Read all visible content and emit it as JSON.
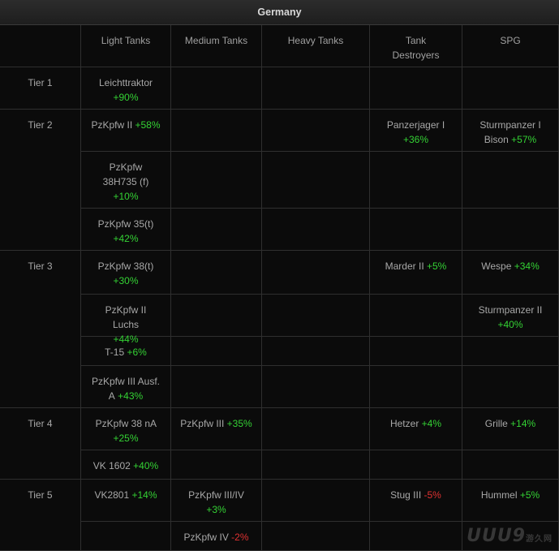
{
  "title": "Germany",
  "headers": [
    "",
    "Light Tanks",
    "Medium Tanks",
    "Heavy Tanks",
    "Tank Destroyers",
    "SPG"
  ],
  "tiers": [
    "Tier 1",
    "Tier 2",
    "Tier 3",
    "Tier 4",
    "Tier 5"
  ],
  "entries": {
    "r0_light": {
      "name": "Leichttraktor",
      "pct": "+90%"
    },
    "r1_light": {
      "name": "PzKpfw II",
      "pct": "+58%"
    },
    "r1_td": {
      "name": "Panzerjager I",
      "pct": "+36%"
    },
    "r1_spg": {
      "name": "Sturmpanzer I Bison",
      "pct": "+57%"
    },
    "r2_light": {
      "name": "PzKpfw 38H735 (f)",
      "pct": "+10%"
    },
    "r3_light": {
      "name": "PzKpfw 35(t)",
      "pct": "+42%"
    },
    "r4_light": {
      "name": "PzKpfw 38(t)",
      "pct": "+30%"
    },
    "r4_td": {
      "name": "Marder II",
      "pct": "+5%"
    },
    "r4_spg": {
      "name": "Wespe",
      "pct": "+34%"
    },
    "r5_light": {
      "name": "PzKpfw II Luchs",
      "pct": "+44%"
    },
    "r5_spg": {
      "name": "Sturmpanzer II",
      "pct": "+40%"
    },
    "r6_light": {
      "name": "T-15",
      "pct": "+6%"
    },
    "r7_light": {
      "name": "PzKpfw III Ausf. A",
      "pct": "+43%"
    },
    "r8_light": {
      "name": "PzKpfw 38 nA",
      "pct": "+25%"
    },
    "r8_medium": {
      "name": "PzKpfw III",
      "pct": "+35%"
    },
    "r8_td": {
      "name": "Hetzer",
      "pct": "+4%"
    },
    "r8_spg": {
      "name": "Grille",
      "pct": "+14%"
    },
    "r9_light": {
      "name": "VK 1602",
      "pct": "+40%"
    },
    "r10_light": {
      "name": "VK2801",
      "pct": "+14%"
    },
    "r10_medium": {
      "name": "PzKpfw III/IV",
      "pct": "+3%"
    },
    "r10_td": {
      "name": "Stug III",
      "pct": "-5%"
    },
    "r10_spg": {
      "name": "Hummel",
      "pct": "+5%"
    },
    "r11_medium": {
      "name": "PzKpfw IV",
      "pct": "-2%"
    }
  },
  "watermark": {
    "text": "UUU9",
    "sub": "游久网",
    "domain": ".com"
  },
  "colors": {
    "positive": "#34d234",
    "negative": "#e03232"
  }
}
